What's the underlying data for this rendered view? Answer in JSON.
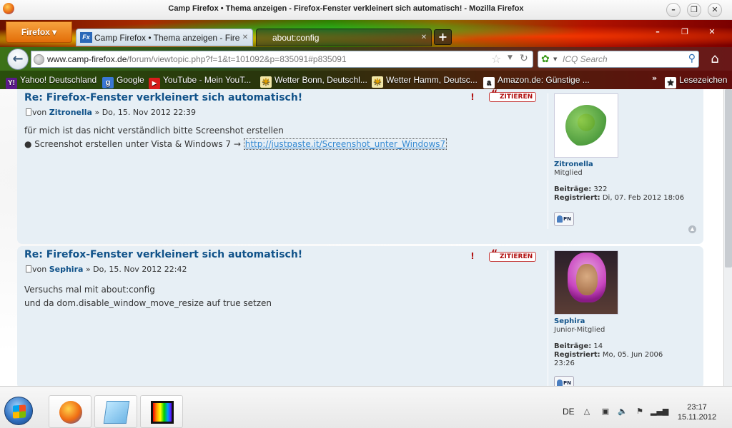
{
  "window": {
    "title": "Camp Firefox • Thema anzeigen - Firefox-Fenster verkleinert sich automatisch! - Mozilla Firefox",
    "controls": {
      "minimize": "–",
      "maximize": "❐",
      "close": "✕"
    }
  },
  "browser": {
    "menu_button": "Firefox ▾",
    "tabs": [
      {
        "favicon": "Fx",
        "label": "Camp Firefox • Thema anzeigen - Fire",
        "close": "✕",
        "active": true
      },
      {
        "label": "about:config",
        "close": "✕",
        "active": false
      }
    ],
    "new_tab": "+",
    "sys_controls": {
      "minimize": "–",
      "maximize": "❐",
      "close": "✕"
    },
    "url": {
      "host": "www.camp-firefox.de",
      "path": "/forum/viewtopic.php?f=1&t=101092&p=835091#p835091"
    },
    "search": {
      "placeholder": "ICQ Search"
    },
    "icons": {
      "back": "←",
      "star": "☆",
      "dropdown": "▼",
      "reload": "↻",
      "search": "⚲",
      "home": "⌂",
      "icq": "✿"
    }
  },
  "bookmarks": [
    {
      "icon": "Y!",
      "label": "Yahoo! Deutschland"
    },
    {
      "icon": "g",
      "label": "Google"
    },
    {
      "icon": "▶",
      "label": "YouTube - Mein YouT..."
    },
    {
      "icon": "☀",
      "label": "Wetter Bonn, Deutschl..."
    },
    {
      "icon": "☀",
      "label": "Wetter Hamm, Deutsc..."
    },
    {
      "icon": "a",
      "label": "Amazon.de: Günstige ..."
    },
    {
      "icon": "★",
      "label": "Lesezeichen"
    }
  ],
  "bookmarks_more": "»",
  "posts": [
    {
      "title": "Re: Firefox-Fenster verkleinert sich automatisch!",
      "by": "von",
      "author": "Zitronella",
      "date": "» Do, 15. Nov 2012 22:39",
      "line1": "für mich ist das nicht verständlich bitte Screenshot erstellen",
      "line2_prefix": "● Screenshot erstellen unter Vista & Windows 7 →",
      "link": "http://justpaste.it/Screenshot_unter_Windows7",
      "quote": "ZITIEREN",
      "report": "!",
      "profile": {
        "username": "Zitronella",
        "rank": "Mitglied",
        "posts_label": "Beiträge:",
        "posts": "322",
        "registered_label": "Registriert:",
        "registered": "Di, 07. Feb 2012 18:06",
        "pm": "PN"
      },
      "top": "▲"
    },
    {
      "title": "Re: Firefox-Fenster verkleinert sich automatisch!",
      "by": "von",
      "author": "Sephira",
      "date": "» Do, 15. Nov 2012 22:42",
      "line1": "Versuchs mal mit about:config",
      "line2": "und da dom.disable_window_move_resize auf true setzen",
      "quote": "ZITIEREN",
      "report": "!",
      "profile": {
        "username": "Sephira",
        "rank": "Junior-Mitglied",
        "posts_label": "Beiträge:",
        "posts": "14",
        "registered_label": "Registriert:",
        "registered": "Mo, 05. Jun 2006",
        "registered_time": "23:26",
        "pm": "PN"
      }
    }
  ],
  "taskbar": {
    "language": "DE",
    "tray": {
      "arrow": "△",
      "device": "▣",
      "volume": "🔈",
      "flag": "⚑",
      "signal": "▂▄▆"
    },
    "time": "23:17",
    "date": "15.11.2012"
  }
}
